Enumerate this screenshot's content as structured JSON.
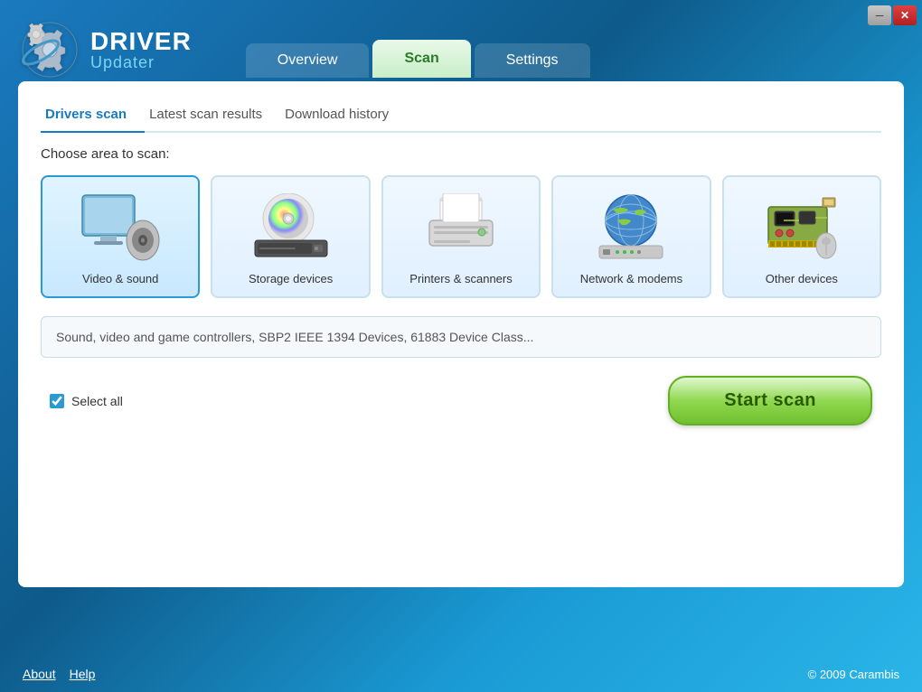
{
  "window": {
    "minimize_label": "─",
    "close_label": "✕"
  },
  "logo": {
    "driver_text": "DRIVER",
    "updater_text": "Updater"
  },
  "nav_tabs": [
    {
      "id": "overview",
      "label": "Overview",
      "active": false
    },
    {
      "id": "scan",
      "label": "Scan",
      "active": true
    },
    {
      "id": "settings",
      "label": "Settings",
      "active": false
    }
  ],
  "sub_tabs": [
    {
      "id": "drivers-scan",
      "label": "Drivers scan",
      "active": true
    },
    {
      "id": "latest-scan-results",
      "label": "Latest scan results",
      "active": false
    },
    {
      "id": "download-history",
      "label": "Download history",
      "active": false
    }
  ],
  "choose_area_label": "Choose area to scan:",
  "device_cards": [
    {
      "id": "video-sound",
      "label": "Video & sound",
      "selected": true
    },
    {
      "id": "storage-devices",
      "label": "Storage devices",
      "selected": false
    },
    {
      "id": "printers-scanners",
      "label": "Printers & scanners",
      "selected": false
    },
    {
      "id": "network-modems",
      "label": "Network & modems",
      "selected": false
    },
    {
      "id": "other-devices",
      "label": "Other devices",
      "selected": false
    }
  ],
  "description": "Sound, video and game controllers, SBP2 IEEE 1394 Devices, 61883 Device Class...",
  "select_all_label": "Select all",
  "start_scan_label": "Start scan",
  "footer": {
    "about_label": "About",
    "help_label": "Help",
    "copyright": "© 2009 Carambis"
  }
}
